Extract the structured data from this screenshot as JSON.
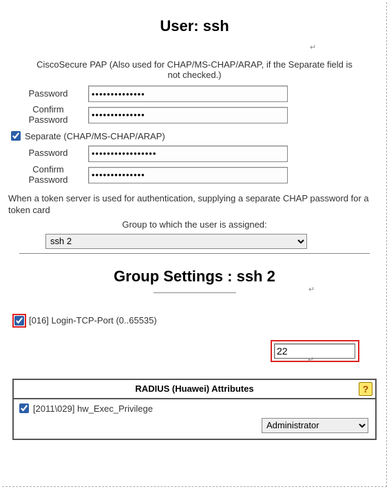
{
  "user": {
    "title": "User: ssh",
    "pap_note": "CiscoSecure PAP (Also used for CHAP/MS-CHAP/ARAP, if the Separate field is not checked.)",
    "password_label": "Password",
    "confirm_label": "Confirm Password",
    "password1": "••••••••••••••",
    "confirm1": "••••••••••••••",
    "separate_checked": true,
    "separate_label": "Separate (CHAP/MS-CHAP/ARAP)",
    "password2": "•••••••••••••••••",
    "confirm2": "••••••••••••••",
    "token_note": "When a token server is used for authentication, supplying a separate CHAP password for a token card",
    "group_assign_label": "Group to which the user is assigned:",
    "group_selected": "ssh 2",
    "group_options": [
      "ssh 2"
    ]
  },
  "group": {
    "title": "Group Settings : ssh 2",
    "login_port": {
      "checked": true,
      "label": "[016] Login-TCP-Port (0..65535)",
      "value": "22"
    },
    "radius": {
      "title": "RADIUS (Huawei) Attributes",
      "help": "?",
      "exec_priv": {
        "checked": true,
        "label": "[2011\\029] hw_Exec_Privilege",
        "selected": "Administrator",
        "options": [
          "Administrator"
        ]
      }
    }
  }
}
